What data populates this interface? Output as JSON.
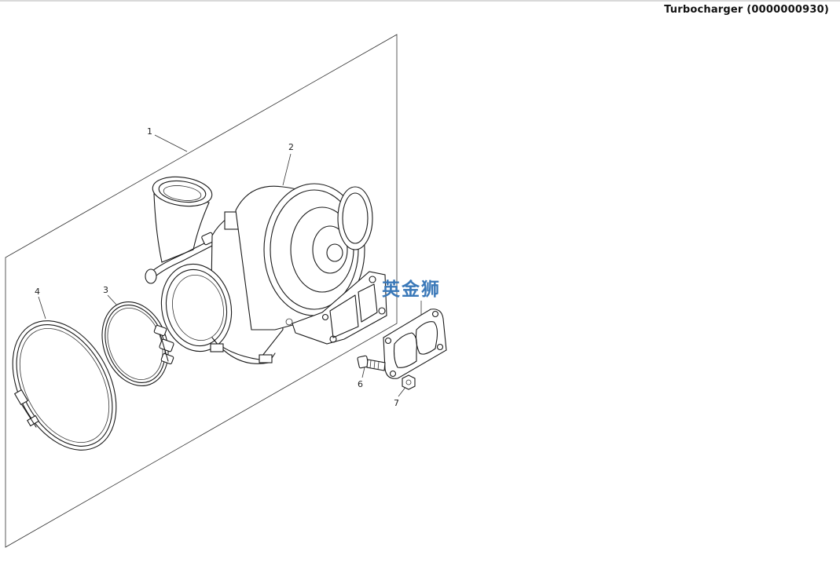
{
  "header": {
    "title": "Turbocharger (0000000930)"
  },
  "diagram": {
    "callouts": [
      "1",
      "2",
      "3",
      "4",
      "6",
      "7"
    ],
    "watermark": "英金狮"
  }
}
